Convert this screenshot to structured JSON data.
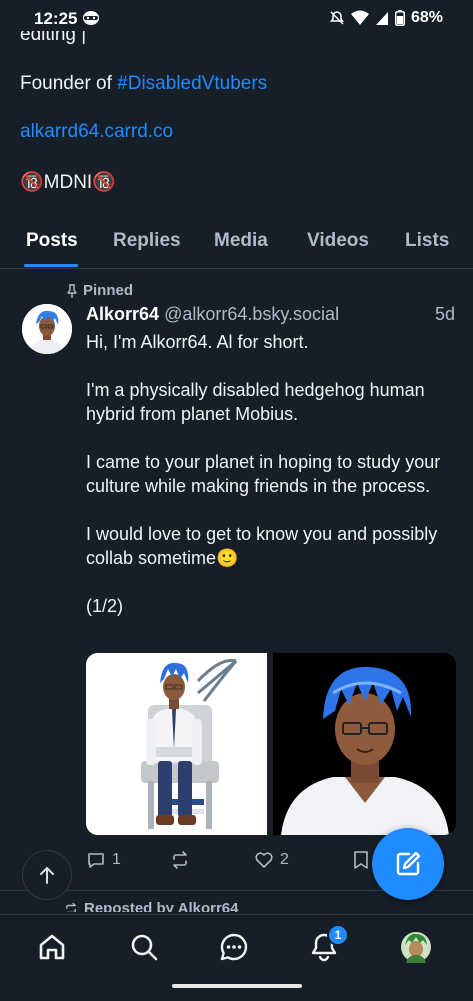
{
  "status_bar": {
    "time": "12:25",
    "battery": "68%"
  },
  "bio": {
    "cut_line": "editing |",
    "founder_prefix": "Founder of ",
    "founder_tag": "#DisabledVtubers",
    "link": "alkarrd64.carrd.co",
    "mdni": "🔞MDNI🔞"
  },
  "tabs": [
    {
      "label": "Posts",
      "active": true
    },
    {
      "label": "Replies"
    },
    {
      "label": "Media"
    },
    {
      "label": "Videos"
    },
    {
      "label": "Lists"
    }
  ],
  "post": {
    "pinned_label": "Pinned",
    "display_name": "Alkorr64",
    "handle": "@alkorr64.bsky.social",
    "age": "5d",
    "text": "Hi, I'm Alkorr64. Al for short.\n\nI'm a physically disabled hedgehog human hybrid from planet Mobius.\n\nI came to your planet in hoping to study your culture while making friends in the process.\n\nI would love to get to know you and possibly collab sometime🙂\n\n(1/2)",
    "reply_count": "1",
    "like_count": "2"
  },
  "next_post": {
    "repost_label": "Reposted by Alkorr64"
  },
  "nav": {
    "notification_badge": "1"
  },
  "colors": {
    "accent": "#208bfe",
    "background": "#161e27",
    "muted": "#aebbc9"
  }
}
